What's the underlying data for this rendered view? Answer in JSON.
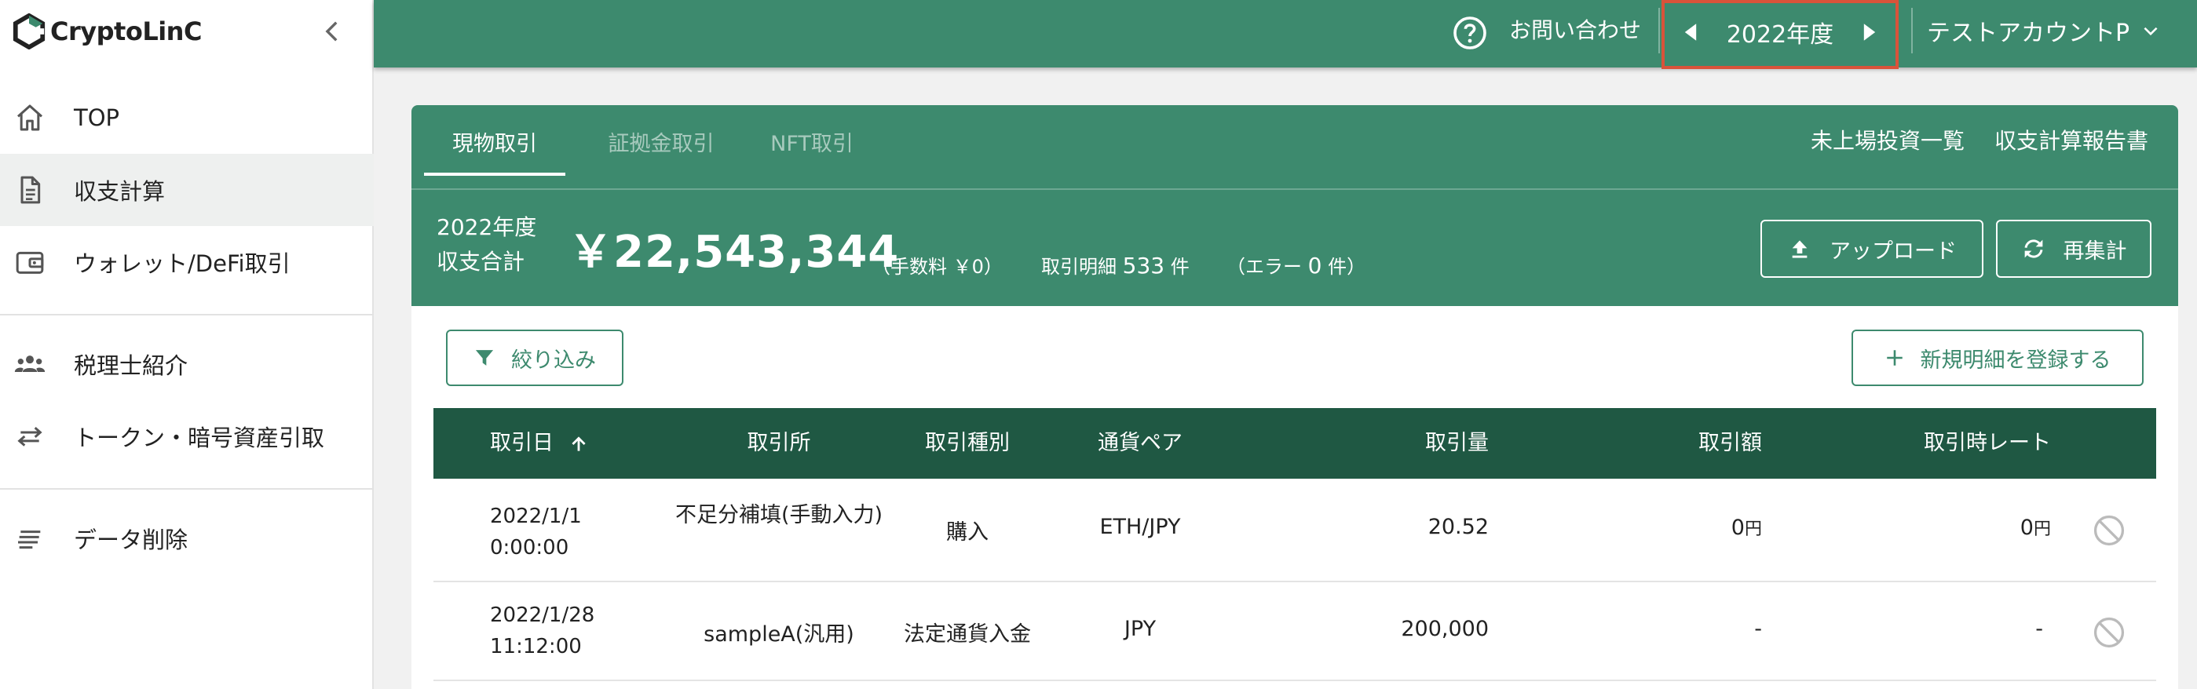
{
  "sidebar": {
    "logo_text": "CryptoLinC",
    "items": [
      {
        "label": "TOP",
        "icon": "home-icon"
      },
      {
        "label": "収支計算",
        "icon": "document-icon"
      },
      {
        "label": "ウォレット/DeFi取引",
        "icon": "wallet-icon"
      },
      {
        "label": "税理士紹介",
        "icon": "people-icon"
      },
      {
        "label": "トークン・暗号資産引取",
        "icon": "swap-icon"
      },
      {
        "label": "データ削除",
        "icon": "lines-icon"
      }
    ],
    "active_index": 1
  },
  "header": {
    "contact": "お問い合わせ",
    "year": "2022年度",
    "account": "テストアカウントP"
  },
  "tabs": [
    {
      "label": "現物取引",
      "active": true
    },
    {
      "label": "証拠金取引",
      "active": false
    },
    {
      "label": "NFT取引",
      "active": false
    }
  ],
  "links": {
    "unlisted": "未上場投資一覧",
    "report": "収支計算報告書"
  },
  "summary": {
    "year": "2022年度",
    "label": "収支合計",
    "amount": "￥22,543,344",
    "fee": "（手数料 ￥0）",
    "detail_label": "取引明細",
    "detail_count": "533",
    "detail_unit": "件",
    "error_text": "（エラー",
    "error_count": "0",
    "error_unit": "件）"
  },
  "buttons": {
    "upload": "アップロード",
    "recalc": "再集計",
    "filter": "絞り込み",
    "new": "新規明細を登録する"
  },
  "table": {
    "headers": [
      "取引日",
      "取引所",
      "取引種別",
      "通貨ペア",
      "取引量",
      "取引額",
      "取引時レート"
    ],
    "rows": [
      {
        "date": "2022/1/1",
        "time": "0:00:00",
        "exchange": "不足分補填(手動入力)",
        "type": "購入",
        "pair": "ETH/JPY",
        "quantity": "20.52",
        "amount": "0",
        "amount_unit": "円",
        "rate": "0",
        "rate_unit": "円"
      },
      {
        "date": "2022/1/28",
        "time": "11:12:00",
        "exchange": "sampleA(汎用)",
        "type": "法定通貨入金",
        "pair": "JPY",
        "quantity": "200,000",
        "amount": "-",
        "amount_unit": "",
        "rate": "-",
        "rate_unit": ""
      }
    ]
  },
  "colors": {
    "primary": "#3d8a6e",
    "table_header": "#1f5843",
    "highlight_border": "#d9533a"
  }
}
